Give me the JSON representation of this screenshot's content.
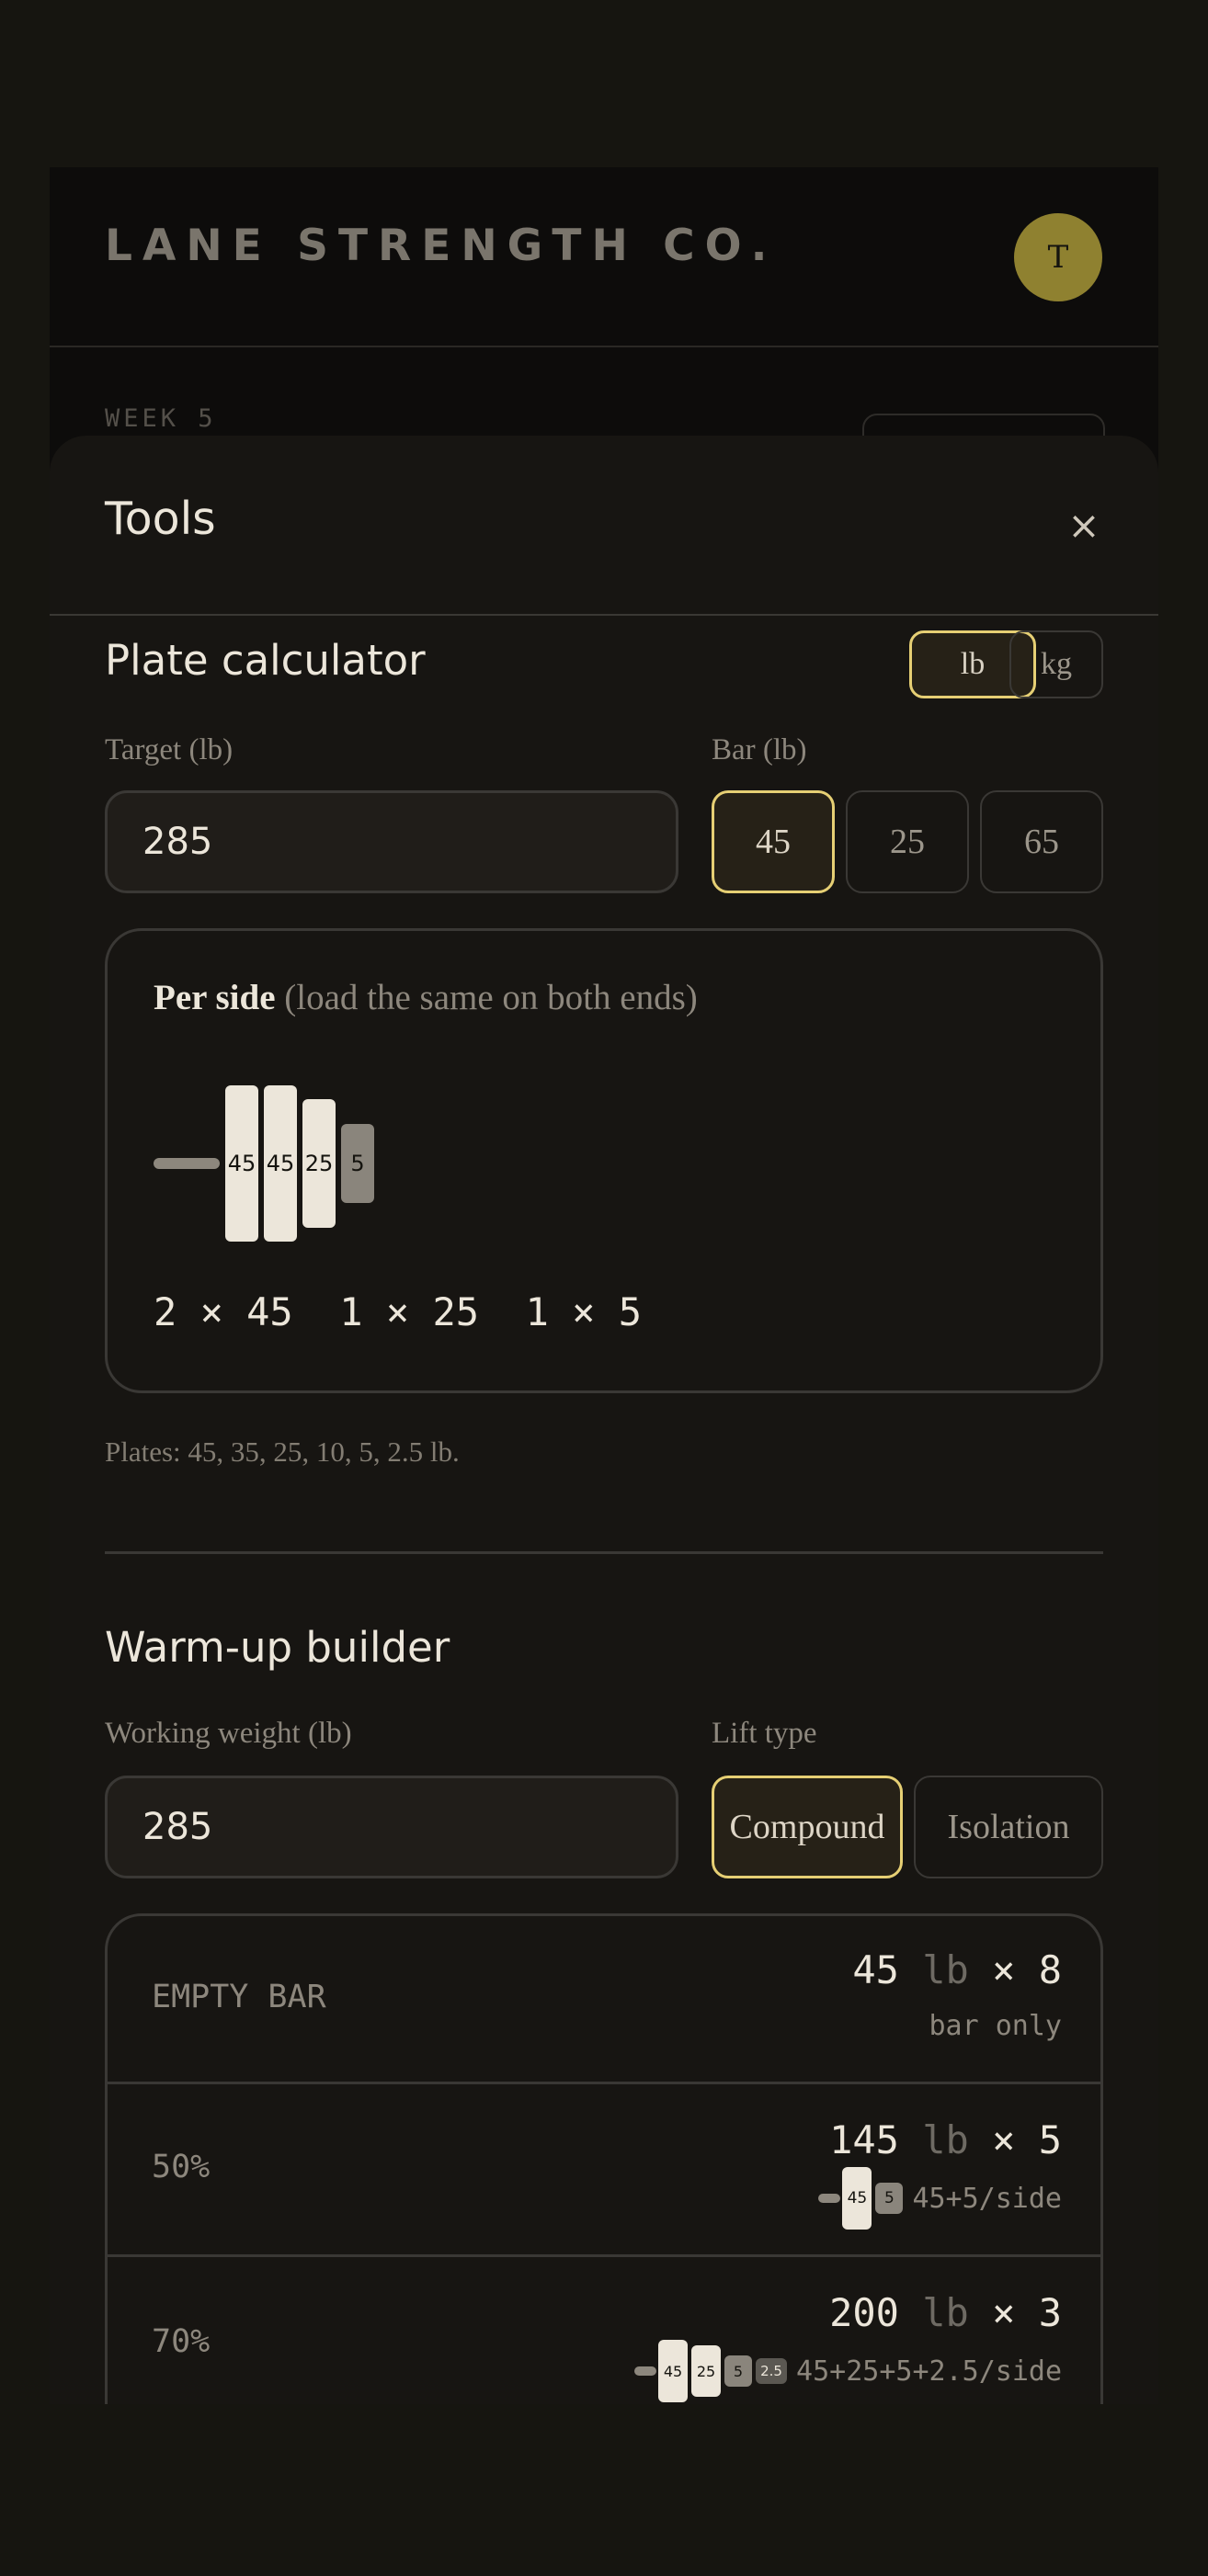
{
  "app": {
    "brand": "LANE STRENGTH CO.",
    "avatar_initial": "T",
    "week_label": "WEEK 5"
  },
  "sheet": {
    "title": "Tools",
    "close_icon": "close-icon",
    "close_glyph": "×"
  },
  "plate_calculator": {
    "heading": "Plate calculator",
    "units": [
      {
        "label": "lb",
        "active": true
      },
      {
        "label": "kg",
        "active": false
      }
    ],
    "target_label": "Target (lb)",
    "target_value": "285",
    "bar_label": "Bar (lb)",
    "bar_options": [
      {
        "label": "45",
        "active": true
      },
      {
        "label": "25",
        "active": false
      },
      {
        "label": "65",
        "active": false
      }
    ],
    "per_side_title": "Per side",
    "per_side_hint": "(load the same on both ends)",
    "plates": [
      "45",
      "45",
      "25",
      "5"
    ],
    "counts": [
      "2 × 45",
      "1 × 25",
      "1 × 5"
    ],
    "plates_note": "Plates: 45, 35, 25, 10, 5, 2.5 lb."
  },
  "warmup_builder": {
    "heading": "Warm-up builder",
    "working_weight_label": "Working weight (lb)",
    "working_weight_value": "285",
    "lift_type_label": "Lift type",
    "lift_types": [
      {
        "label": "Compound",
        "active": true
      },
      {
        "label": "Isolation",
        "active": false
      }
    ],
    "rows": [
      {
        "label": "EMPTY BAR",
        "weight": "45",
        "unit": "lb",
        "reps": "× 8",
        "detail": "bar only",
        "plates": []
      },
      {
        "label": "50%",
        "weight": "145",
        "unit": "lb",
        "reps": "× 5",
        "detail": "45+5/side",
        "plates": [
          "45",
          "5"
        ]
      },
      {
        "label": "70%",
        "weight": "200",
        "unit": "lb",
        "reps": "× 3",
        "detail": "45+25+5+2.5/side",
        "plates": [
          "45",
          "25",
          "5",
          "2.5"
        ]
      }
    ]
  },
  "colors": {
    "accent": "#e6cf74",
    "avatar": "#8f8130",
    "background": "#161510",
    "surface": "#171512"
  }
}
